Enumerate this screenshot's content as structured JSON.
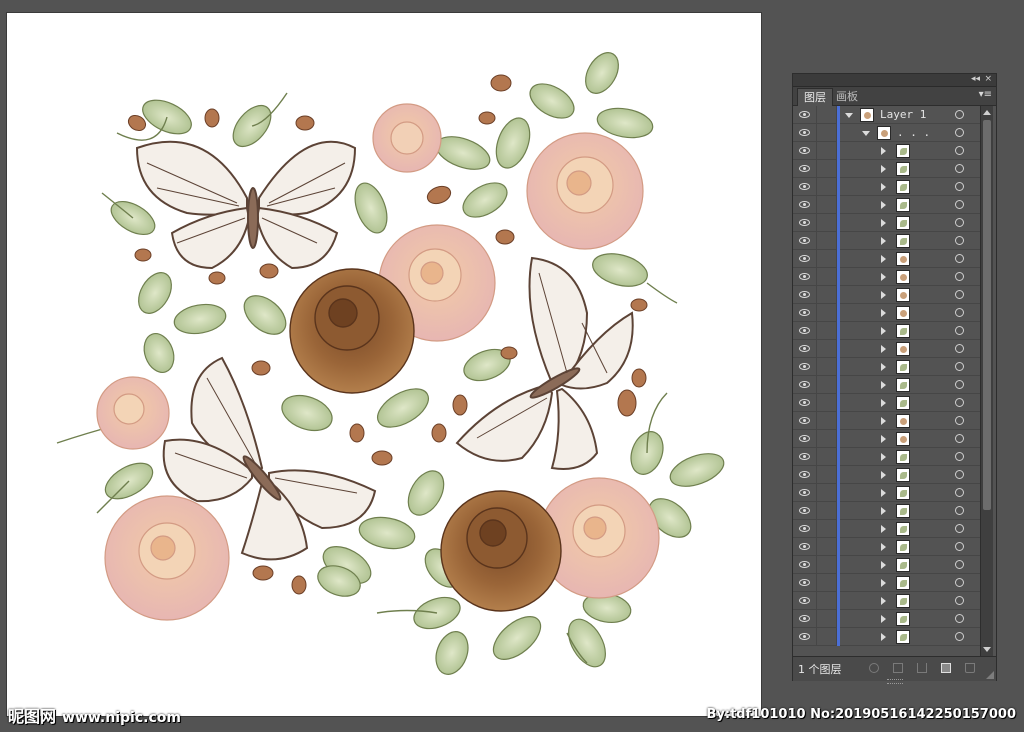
{
  "panel": {
    "tabs": [
      {
        "label": "图层",
        "active": true
      },
      {
        "label": "画板",
        "active": false
      }
    ],
    "top_layer": {
      "name": "Layer 1"
    },
    "group_row": {
      "name": ". . ."
    },
    "item_thumbs": [
      "leaf",
      "leaf",
      "leaf",
      "leaf",
      "leaf",
      "leaf",
      "rose",
      "rose",
      "rose",
      "rose",
      "leaf",
      "rose",
      "leaf",
      "leaf",
      "leaf",
      "rose",
      "rose",
      "leaf",
      "leaf",
      "leaf",
      "leaf",
      "leaf",
      "leaf",
      "leaf",
      "leaf",
      "leaf",
      "leaf",
      "leaf"
    ],
    "footer": {
      "layer_count": "1 个图层"
    },
    "icons": {
      "collapse": "double-chevron-icon",
      "close": "close-icon",
      "menu": "panel-menu-icon"
    },
    "colors": {
      "layer_color": "#4b6fd6",
      "panel_bg": "#535353"
    }
  },
  "watermark": {
    "site_cn": "昵图网",
    "site_url": "www.nipic.com",
    "credit": "By:tdf101010 No:20190516142250157000"
  }
}
